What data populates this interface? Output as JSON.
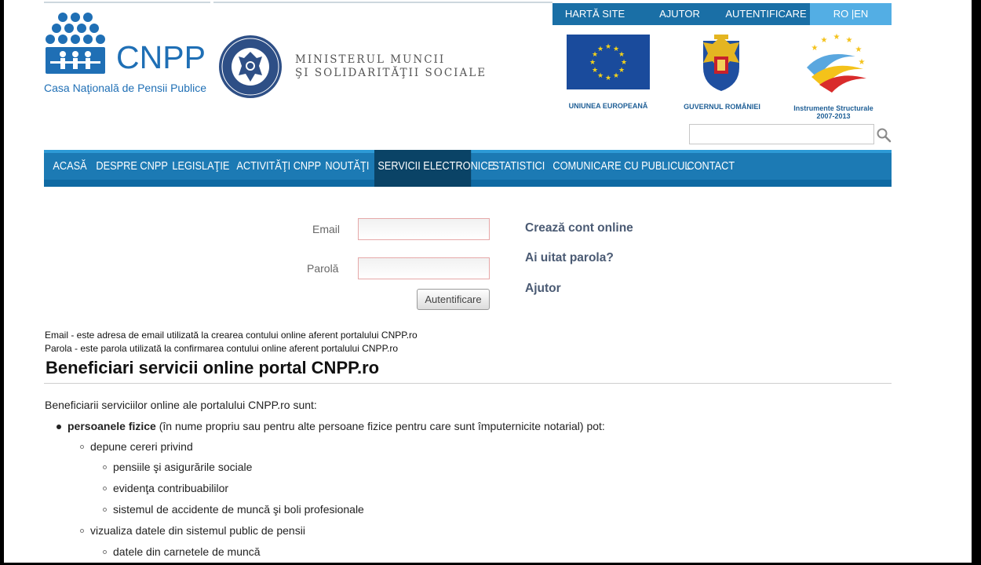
{
  "header": {
    "topbar": [
      "HARTĂ SITE",
      "AJUTOR",
      "AUTENTIFICARE"
    ],
    "lang": "RO |EN",
    "logo_title": "CNPP",
    "logo_subtitle": "Casa Naţională de Pensii Publice",
    "ministry_line1": "MINISTERUL MUNCII",
    "ministry_line2": "ŞI SOLIDARITĂŢII SOCIALE",
    "flags": {
      "eu": "UNIUNEA EUROPEANĂ",
      "gov": "GUVERNUL ROMÂNIEI",
      "instr_line1": "Instrumente Structurale",
      "instr_line2": "2007-2013"
    },
    "seal_text": "GUVERNUL ROMÂNIEI"
  },
  "colors": {
    "accent": "#1c7ab4",
    "nav_active": "#0a4366",
    "topbar_dark": "#1a6fa6",
    "topbar_light": "#53aee4",
    "logo_blue": "#1f6fb5"
  },
  "nav": [
    "ACASĂ",
    "DESPRE CNPP",
    "LEGISLAŢIE",
    "ACTIVITĂŢI CNPP",
    "NOUTĂŢI",
    "SERVICII ELECTRONICE",
    "STATISTICI",
    "COMUNICARE CU PUBLICUL",
    "CONTACT"
  ],
  "nav_active_index": 5,
  "login": {
    "email_label": "Email",
    "email_value": "",
    "password_label": "Parolă",
    "password_value": "",
    "submit": "Autentificare",
    "create_account": "Crează cont online",
    "forgot": "Ai uitat parola?",
    "help": "Ajutor"
  },
  "notes": {
    "email": "Email - este adresa de email utilizată la crearea contului online aferent portalului CNPP.ro",
    "password": "Parola - este parola utilizată la confirmarea contului online aferent portalului CNPP.ro"
  },
  "content": {
    "title": "Beneficiari servicii online portal CNPP.ro",
    "intro": "Beneficiarii serviciilor online ale portalului CNPP.ro sunt:",
    "level1_bold": "persoanele fizice",
    "level1_rest": " (în nume propriu sau pentru alte persoane fizice pentru care sunt împuternicite notarial) pot:",
    "item_a": "depune cereri privind",
    "item_a1": "pensiile şi asigurările sociale",
    "item_a2": "evidenţa contribuabililor",
    "item_a3": "sistemul de accidente de muncă şi boli profesionale",
    "item_b": "vizualiza datele din sistemul public de pensii",
    "item_b1": "datele din carnetele de muncă"
  }
}
